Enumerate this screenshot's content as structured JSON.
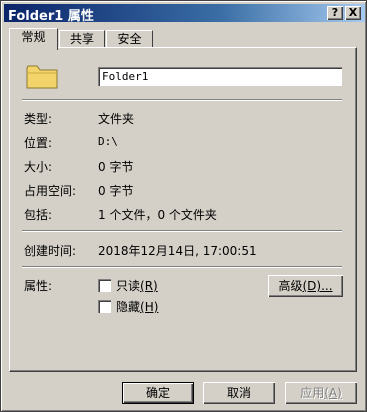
{
  "window": {
    "title": "Folder1 属性",
    "help_label": "?",
    "close_label": "X"
  },
  "tabs": [
    {
      "label": "常规",
      "active": true
    },
    {
      "label": "共享",
      "active": false
    },
    {
      "label": "安全",
      "active": false
    }
  ],
  "general": {
    "icon": "folder-icon",
    "name_value": "Folder1",
    "type_label": "类型:",
    "type_value": "文件夹",
    "location_label": "位置:",
    "location_value": "D:\\",
    "size_label": "大小:",
    "size_value": "0 字节",
    "size_on_disk_label": "占用空间:",
    "size_on_disk_value": "0 字节",
    "contains_label": "包括:",
    "contains_value": "1 个文件，0 个文件夹",
    "created_label": "创建时间:",
    "created_value": "2018年12月14日, 17:00:51",
    "attributes_label": "属性:",
    "readonly_label": "只读",
    "readonly_key": "(R)",
    "readonly_checked": false,
    "hidden_label": "隐藏",
    "hidden_key": "(H)",
    "hidden_checked": false,
    "advanced_label": "高级",
    "advanced_key": "(D)..."
  },
  "footer": {
    "ok_label": "确定",
    "cancel_label": "取消",
    "apply_label": "应用",
    "apply_key": "(A)"
  },
  "colors": {
    "face": "#d4d0c8",
    "title_start": "#0a246a",
    "title_end": "#a6caf0",
    "folder": "#f2d46a"
  }
}
